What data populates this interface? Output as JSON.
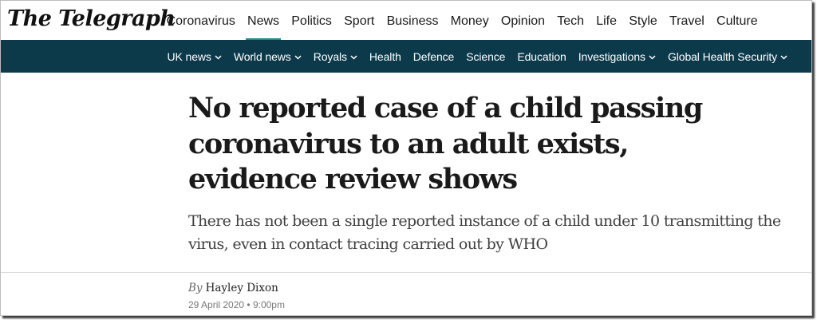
{
  "brand": {
    "logo_text": "The Telegraph",
    "accent_color": "#1e8c89",
    "subnav_color": "#0c3a4b"
  },
  "sections": [
    {
      "label": "Coronavirus"
    },
    {
      "label": "News",
      "active": true
    },
    {
      "label": "Politics"
    },
    {
      "label": "Sport"
    },
    {
      "label": "Business"
    },
    {
      "label": "Money"
    },
    {
      "label": "Opinion"
    },
    {
      "label": "Tech"
    },
    {
      "label": "Life"
    },
    {
      "label": "Style"
    },
    {
      "label": "Travel"
    },
    {
      "label": "Culture"
    }
  ],
  "subnav": [
    {
      "label": "UK news",
      "has_dropdown": true
    },
    {
      "label": "World news",
      "has_dropdown": true
    },
    {
      "label": "Royals",
      "has_dropdown": true
    },
    {
      "label": "Health",
      "has_dropdown": false
    },
    {
      "label": "Defence",
      "has_dropdown": false
    },
    {
      "label": "Science",
      "has_dropdown": false
    },
    {
      "label": "Education",
      "has_dropdown": false
    },
    {
      "label": "Investigations",
      "has_dropdown": true
    },
    {
      "label": "Global Health Security",
      "has_dropdown": true
    }
  ],
  "article": {
    "headline": "No reported case of a child passing coronavirus to an adult exists, evidence review shows",
    "standfirst": "There has not been a single reported instance of a child under 10 transmitting the virus, even in contact tracing carried out by WHO",
    "byline_prefix": "By",
    "author": "Hayley Dixon",
    "date": "29 April 2020",
    "time": "9:00pm",
    "date_separator": "•"
  }
}
